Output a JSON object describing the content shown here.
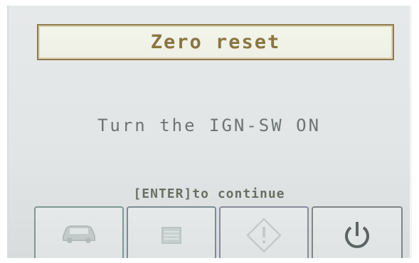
{
  "screen": {
    "title": "Zero reset",
    "message": "Turn the IGN-SW ON",
    "hint": "[ENTER]to continue"
  },
  "softkeys": [
    {
      "icon": "car-icon",
      "enabled": false
    },
    {
      "icon": "document-icon",
      "enabled": false
    },
    {
      "icon": "warning-diamond-icon",
      "enabled": false
    },
    {
      "icon": "power-icon",
      "enabled": true
    }
  ],
  "colors": {
    "title_border": "#8f7a4a",
    "title_text": "#8a7542",
    "message_text": "#6e7374",
    "disabled_icon": "#b9c0c0",
    "enabled_icon": "#5d6466"
  }
}
